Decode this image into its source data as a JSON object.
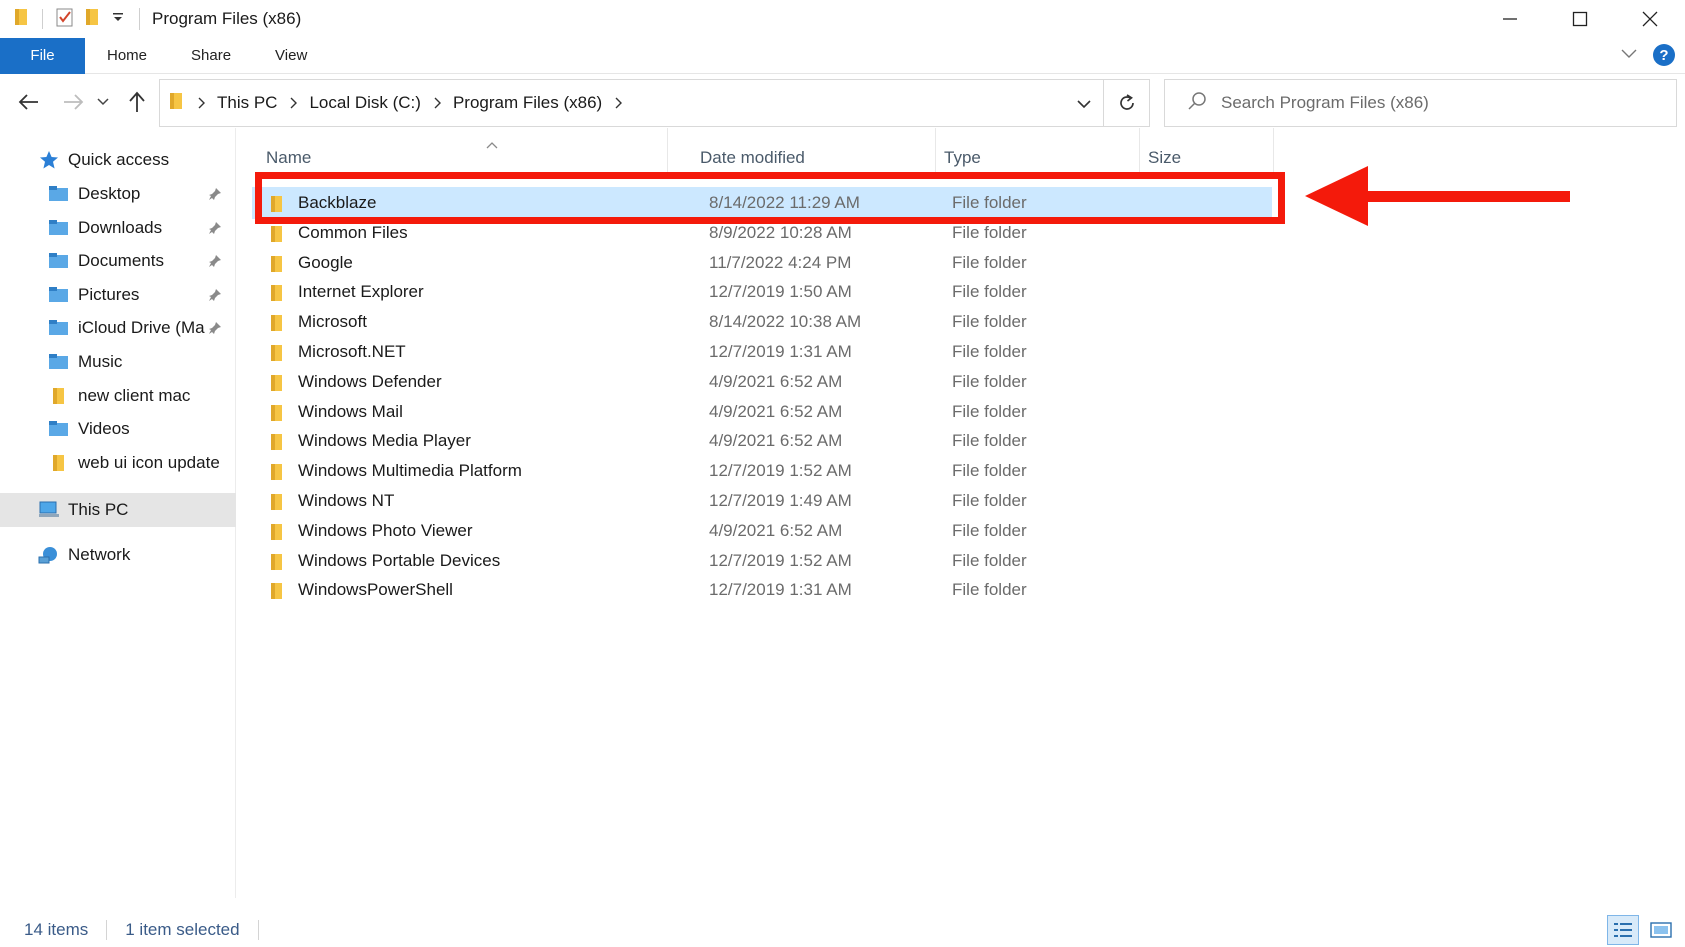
{
  "window": {
    "title": "Program Files (x86)"
  },
  "ribbon": {
    "tabs": [
      "File",
      "Home",
      "Share",
      "View"
    ]
  },
  "address": {
    "crumbs": [
      "This PC",
      "Local Disk (C:)",
      "Program Files (x86)"
    ]
  },
  "search": {
    "placeholder": "Search Program Files (x86)"
  },
  "sidebar": {
    "quick_access": "Quick access",
    "items": [
      {
        "label": "Desktop",
        "pinned": true,
        "icon": "desktop-folder-icon"
      },
      {
        "label": "Downloads",
        "pinned": true,
        "icon": "downloads-folder-icon"
      },
      {
        "label": "Documents",
        "pinned": true,
        "icon": "documents-folder-icon"
      },
      {
        "label": "Pictures",
        "pinned": true,
        "icon": "pictures-folder-icon"
      },
      {
        "label": "iCloud Drive (Ma",
        "pinned": true,
        "icon": "icloud-folder-icon"
      },
      {
        "label": "Music",
        "pinned": false,
        "icon": "music-folder-icon"
      },
      {
        "label": "new client mac",
        "pinned": false,
        "icon": "folder-icon"
      },
      {
        "label": "Videos",
        "pinned": false,
        "icon": "videos-folder-icon"
      },
      {
        "label": "web ui icon update",
        "pinned": false,
        "icon": "folder-icon"
      }
    ],
    "this_pc": "This PC",
    "network": "Network"
  },
  "columns": {
    "name": "Name",
    "date": "Date modified",
    "type": "Type",
    "size": "Size"
  },
  "files": [
    {
      "name": "Backblaze",
      "date": "8/14/2022 11:29 AM",
      "type": "File folder",
      "selected": true
    },
    {
      "name": "Common Files",
      "date": "8/9/2022 10:28 AM",
      "type": "File folder"
    },
    {
      "name": "Google",
      "date": "11/7/2022 4:24 PM",
      "type": "File folder"
    },
    {
      "name": "Internet Explorer",
      "date": "12/7/2019 1:50 AM",
      "type": "File folder"
    },
    {
      "name": "Microsoft",
      "date": "8/14/2022 10:38 AM",
      "type": "File folder"
    },
    {
      "name": "Microsoft.NET",
      "date": "12/7/2019 1:31 AM",
      "type": "File folder"
    },
    {
      "name": "Windows Defender",
      "date": "4/9/2021 6:52 AM",
      "type": "File folder"
    },
    {
      "name": "Windows Mail",
      "date": "4/9/2021 6:52 AM",
      "type": "File folder"
    },
    {
      "name": "Windows Media Player",
      "date": "4/9/2021 6:52 AM",
      "type": "File folder"
    },
    {
      "name": "Windows Multimedia Platform",
      "date": "12/7/2019 1:52 AM",
      "type": "File folder"
    },
    {
      "name": "Windows NT",
      "date": "12/7/2019 1:49 AM",
      "type": "File folder"
    },
    {
      "name": "Windows Photo Viewer",
      "date": "4/9/2021 6:52 AM",
      "type": "File folder"
    },
    {
      "name": "Windows Portable Devices",
      "date": "12/7/2019 1:52 AM",
      "type": "File folder"
    },
    {
      "name": "WindowsPowerShell",
      "date": "12/7/2019 1:31 AM",
      "type": "File folder"
    }
  ],
  "status": {
    "count": "14 items",
    "selection": "1 item selected"
  },
  "colors": {
    "accent": "#1a6fc7",
    "selection": "#cce8ff",
    "annotation": "#f41a0b",
    "folder": "#f6c544"
  }
}
